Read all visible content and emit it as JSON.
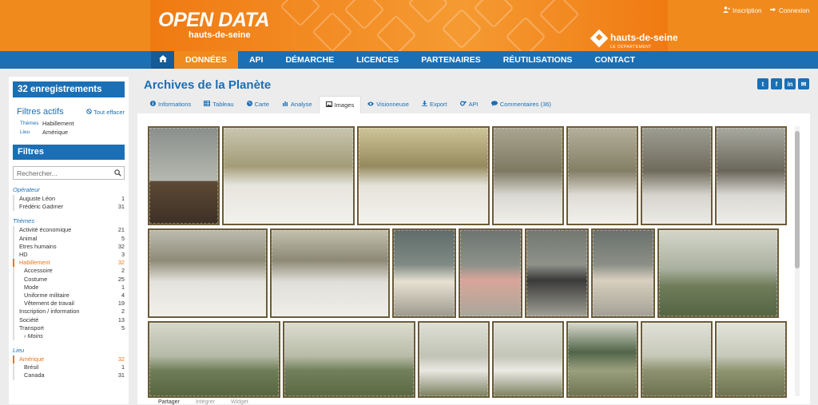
{
  "header": {
    "logo_main": "OPEN DATA",
    "logo_sub": "hauts-de-seine",
    "brand_name": "hauts-de-seine",
    "brand_tag": "LE DÉPARTEMENT",
    "inscription": "Inscription",
    "connexion": "Connexion"
  },
  "nav": {
    "items": [
      "DONNÉES",
      "API",
      "DÉMARCHE",
      "LICENCES",
      "PARTENAIRES",
      "RÉUTILISATIONS",
      "CONTACT"
    ]
  },
  "sidebar": {
    "count": "32 enregistrements",
    "active_title": "Filtres actifs",
    "clear_all": "Tout effacer",
    "active_filters": [
      {
        "key": "Thèmes",
        "value": "Habillement"
      },
      {
        "key": "Lieu",
        "value": "Amérique"
      }
    ],
    "filtres_title": "Filtres",
    "search_placeholder": "Rechercher...",
    "groups": {
      "operateur": {
        "title": "Opérateur",
        "rows": [
          {
            "label": "Auguste Léon",
            "count": "1"
          },
          {
            "label": "Frédéric Gadmer",
            "count": "31"
          }
        ]
      },
      "themes": {
        "title": "Thèmes",
        "rows": [
          {
            "label": "Activité économique",
            "count": "21"
          },
          {
            "label": "Animal",
            "count": "5"
          },
          {
            "label": "Etres humains",
            "count": "32"
          },
          {
            "label": "HD",
            "count": "3"
          },
          {
            "label": "Habillement",
            "count": "32"
          },
          {
            "label": "Accessoire",
            "count": "2"
          },
          {
            "label": "Costume",
            "count": "25"
          },
          {
            "label": "Mode",
            "count": "1"
          },
          {
            "label": "Uniforme militaire",
            "count": "4"
          },
          {
            "label": "Vêtement de travail",
            "count": "19"
          },
          {
            "label": "Inscription / information",
            "count": "2"
          },
          {
            "label": "Société",
            "count": "13"
          },
          {
            "label": "Transport",
            "count": "5"
          }
        ],
        "more": "› Moins"
      },
      "lieu": {
        "title": "Lieu",
        "rows": [
          {
            "label": "Amérique",
            "count": "32"
          },
          {
            "label": "Brésil",
            "count": "1"
          },
          {
            "label": "Canada",
            "count": "31"
          }
        ]
      }
    }
  },
  "main": {
    "title": "Archives de la Planète",
    "social": [
      "t",
      "f",
      "in",
      "✉"
    ],
    "tabs": [
      "Informations",
      "Tableau",
      "Carte",
      "Analyse",
      "Images",
      "Visionneuse",
      "Export",
      "API",
      "Commentaires (36)"
    ],
    "bottom_tabs": [
      "Partager",
      "Intégrer",
      "Widget"
    ]
  },
  "colors": {
    "orange": "#f08a1c",
    "blue": "#1b6fb5",
    "selected": "#e8751a"
  }
}
